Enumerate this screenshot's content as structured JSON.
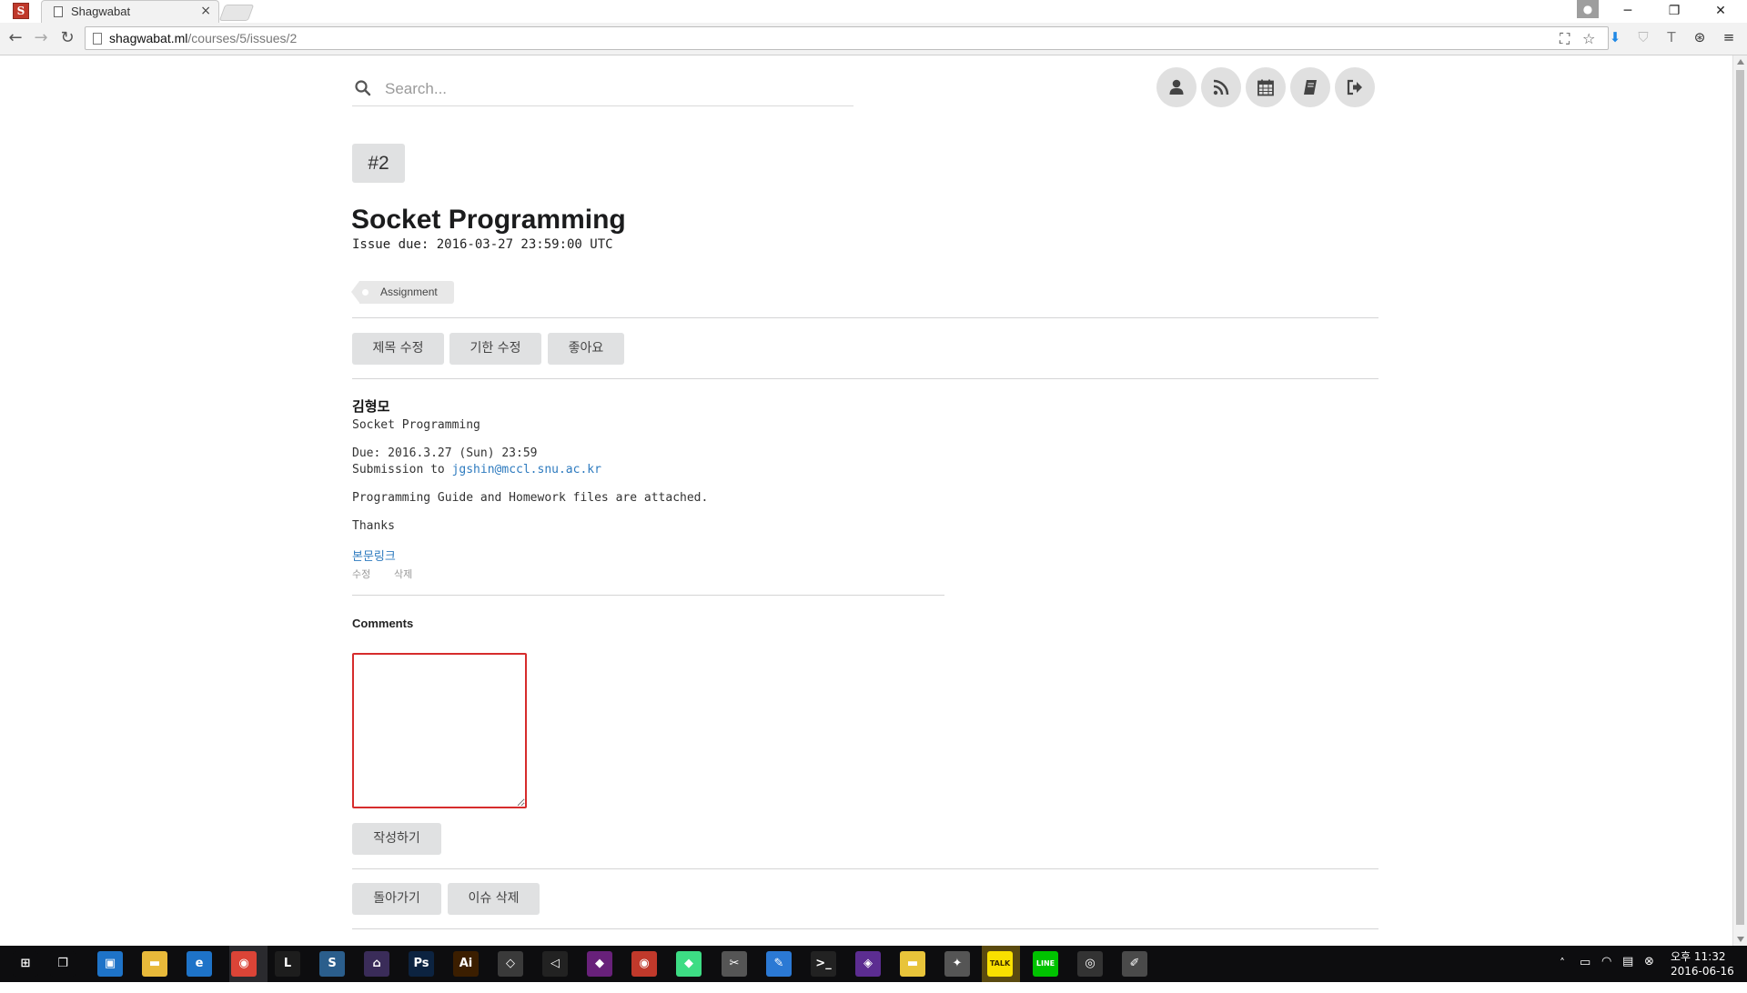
{
  "browser": {
    "tab_title": "Shagwabat",
    "tab_close": "×",
    "url_host": "shagwabat.ml",
    "url_path": "/courses/5/issues/2",
    "window_minimize": "─",
    "window_restore": "❐",
    "window_close": "✕"
  },
  "search": {
    "placeholder": "Search..."
  },
  "top_actions": [
    {
      "name": "user",
      "icon": "user-icon"
    },
    {
      "name": "feed",
      "icon": "rss-icon"
    },
    {
      "name": "calendar",
      "icon": "calendar-icon"
    },
    {
      "name": "book",
      "icon": "book-icon"
    },
    {
      "name": "logout",
      "icon": "sign-out-icon"
    }
  ],
  "issue": {
    "number": "#2",
    "title": "Socket Programming",
    "due": "Issue due: 2016-03-27 23:59:00 UTC",
    "tag": "Assignment",
    "buttons": {
      "edit_title": "제목 수정",
      "edit_due": "기한 수정",
      "like": "좋아요"
    }
  },
  "post": {
    "author": "김형모",
    "subject": "Socket Programming",
    "due_line": "Due: 2016.3.27 (Sun) 23:59",
    "submission_label": "Submission to ",
    "submission_email": "jgshin@mccl.snu.ac.kr",
    "attachment_line": "Programming Guide and Homework files are attached.",
    "thanks": "Thanks",
    "permalink": "본문링크",
    "edit": "수정",
    "delete": "삭제"
  },
  "comments": {
    "label": "Comments",
    "submit": "작성하기",
    "textarea_value": ""
  },
  "footer_buttons": {
    "back": "돌아가기",
    "delete_issue": "이슈 삭제"
  },
  "taskbar": {
    "time": "오후 11:32",
    "date": "2016-06-16",
    "apps": [
      {
        "icon": "windows-start-icon",
        "label": "⊞",
        "color": "#0d0d0f"
      },
      {
        "icon": "task-view-icon",
        "label": "❐",
        "color": "#0d0d0f"
      },
      {
        "icon": "store-icon",
        "label": "▣",
        "color": "#1e73c8"
      },
      {
        "icon": "file-explorer-icon",
        "label": "▬",
        "color": "#e8b93a"
      },
      {
        "icon": "edge-icon",
        "label": "e",
        "color": "#1e73c8"
      },
      {
        "icon": "chrome-icon",
        "label": "◉",
        "color": "#db4437"
      },
      {
        "icon": "lumia-icon",
        "label": "L",
        "color": "#1d1d1d"
      },
      {
        "icon": "app-blue-icon",
        "label": "S",
        "color": "#2b5e8c"
      },
      {
        "icon": "app-purple-icon",
        "label": "⌂",
        "color": "#3a2c59"
      },
      {
        "icon": "photoshop-icon",
        "label": "Ps",
        "color": "#0c2340"
      },
      {
        "icon": "illustrator-icon",
        "label": "Ai",
        "color": "#3b1e00"
      },
      {
        "icon": "cube-icon",
        "label": "◇",
        "color": "#3a3a3a"
      },
      {
        "icon": "unity-icon",
        "label": "◁",
        "color": "#222222"
      },
      {
        "icon": "visual-studio-icon",
        "label": "◆",
        "color": "#68217a"
      },
      {
        "icon": "git-icon",
        "label": "◉",
        "color": "#c0392b"
      },
      {
        "icon": "android-studio-icon",
        "label": "◆",
        "color": "#3ddc84"
      },
      {
        "icon": "snipping-icon",
        "label": "✂",
        "color": "#555555"
      },
      {
        "icon": "paint-icon",
        "label": "✎",
        "color": "#2b79d4"
      },
      {
        "icon": "terminal-icon",
        "label": ">_",
        "color": "#222222"
      },
      {
        "icon": "vs-purple-icon",
        "label": "◈",
        "color": "#5c2d91"
      },
      {
        "icon": "folder-icon",
        "label": "▬",
        "color": "#e8c43a"
      },
      {
        "icon": "rocket-icon",
        "label": "✦",
        "color": "#555555"
      },
      {
        "icon": "kakaotalk-icon",
        "label": "TALK",
        "color": "#f9e000"
      },
      {
        "icon": "line-icon",
        "label": "LINE",
        "color": "#00c300"
      },
      {
        "icon": "camera-icon",
        "label": "◎",
        "color": "#333333"
      },
      {
        "icon": "paint-brush-icon",
        "label": "✐",
        "color": "#4a4a4a"
      }
    ]
  }
}
